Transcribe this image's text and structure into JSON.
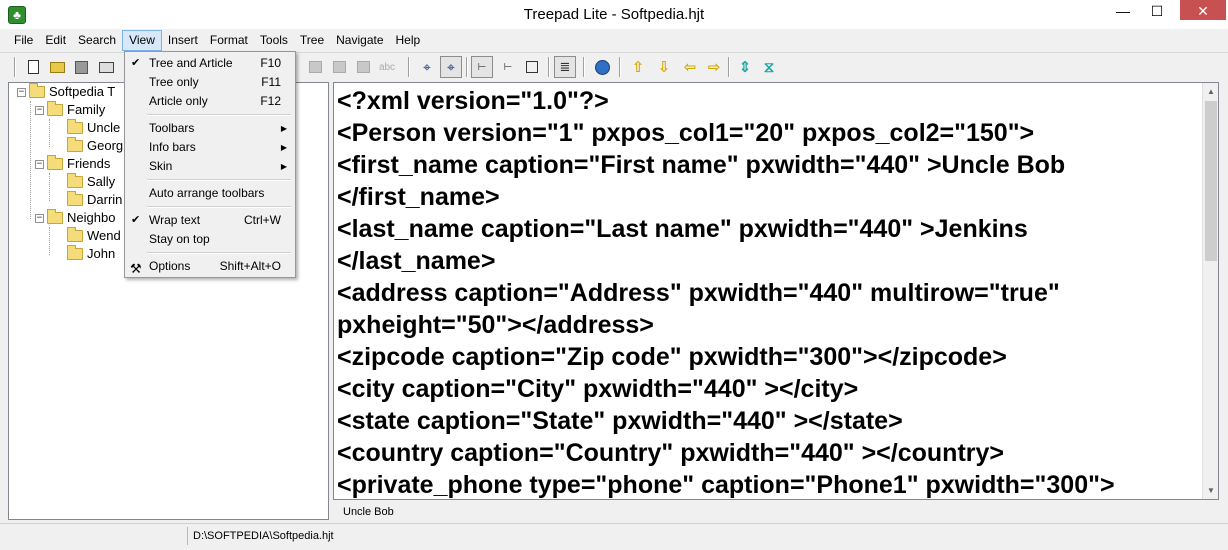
{
  "window": {
    "title": "Treepad Lite - Softpedia.hjt",
    "app_icon": "tree-icon",
    "minimize_glyph": "—",
    "maximize_glyph": "☐",
    "close_glyph": "✕"
  },
  "menubar": {
    "items": [
      "File",
      "Edit",
      "Search",
      "View",
      "Insert",
      "Format",
      "Tools",
      "Tree",
      "Navigate",
      "Help"
    ],
    "active": "View"
  },
  "toolbar": {
    "icons": [
      "new-document-icon",
      "open-folder-icon",
      "save-disk-icon",
      "print-icon",
      "cut-icon",
      "copy-icon",
      "paste-icon",
      "spellcheck-icon",
      "find-icon",
      "find-next-icon",
      "tree-view-icon",
      "tree-article-icon",
      "article-icon",
      "wrap-icon",
      "globe-icon",
      "up-arrow-icon",
      "down-arrow-icon",
      "left-arrow-icon",
      "right-arrow-icon",
      "move-updown-icon",
      "collapse-icon"
    ],
    "spellcheck_label": "abc"
  },
  "tree": {
    "root": "Softpedia T",
    "nodes": [
      {
        "label": "Family",
        "children": [
          "Uncle",
          "Georg"
        ]
      },
      {
        "label": "Friends",
        "children": [
          "Sally",
          "Darrin"
        ]
      },
      {
        "label": "Neighbo",
        "children": [
          "Wend",
          "John"
        ]
      }
    ],
    "expand_glyph": "−"
  },
  "view_menu": {
    "items": [
      {
        "label": "Tree and Article",
        "shortcut": "F10",
        "checked": true
      },
      {
        "label": "Tree only",
        "shortcut": "F11",
        "checked": false
      },
      {
        "label": "Article only",
        "shortcut": "F12",
        "checked": false
      },
      {
        "label": "Toolbars",
        "submenu": true
      },
      {
        "label": "Info bars",
        "submenu": true
      },
      {
        "label": "Skin",
        "submenu": true
      },
      {
        "label": "Auto arrange toolbars"
      },
      {
        "label": "Wrap text",
        "shortcut": "Ctrl+W",
        "checked": true
      },
      {
        "label": "Stay on top"
      },
      {
        "label": "Options",
        "shortcut": "Shift+Alt+O",
        "icon": "tools-icon"
      }
    ],
    "check_glyph": "✔",
    "submenu_glyph": "▶"
  },
  "article": {
    "lines": [
      "<?xml version=\"1.0\"?>",
      "<Person version=\"1\" pxpos_col1=\"20\" pxpos_col2=\"150\">",
      "<first_name caption=\"First name\"  pxwidth=\"440\" >Uncle Bob",
      "</first_name>",
      "<last_name caption=\"Last name\"  pxwidth=\"440\" >Jenkins",
      "</last_name>",
      "<address caption=\"Address\" pxwidth=\"440\" multirow=\"true\"",
      "pxheight=\"50\"></address>",
      "<zipcode caption=\"Zip code\" pxwidth=\"300\"></zipcode>",
      "<city caption=\"City\"  pxwidth=\"440\" ></city>",
      "<state caption=\"State\"  pxwidth=\"440\" ></state>",
      "<country caption=\"Country\"  pxwidth=\"440\" ></country>",
      "<private_phone type=\"phone\" caption=\"Phone1\" pxwidth=\"300\">"
    ]
  },
  "infobar": {
    "node_title": "Uncle Bob"
  },
  "statusbar": {
    "path": "D:\\SOFTPEDIA\\Softpedia.hjt"
  },
  "scrollbar": {
    "up_glyph": "▲",
    "down_glyph": "▼"
  }
}
